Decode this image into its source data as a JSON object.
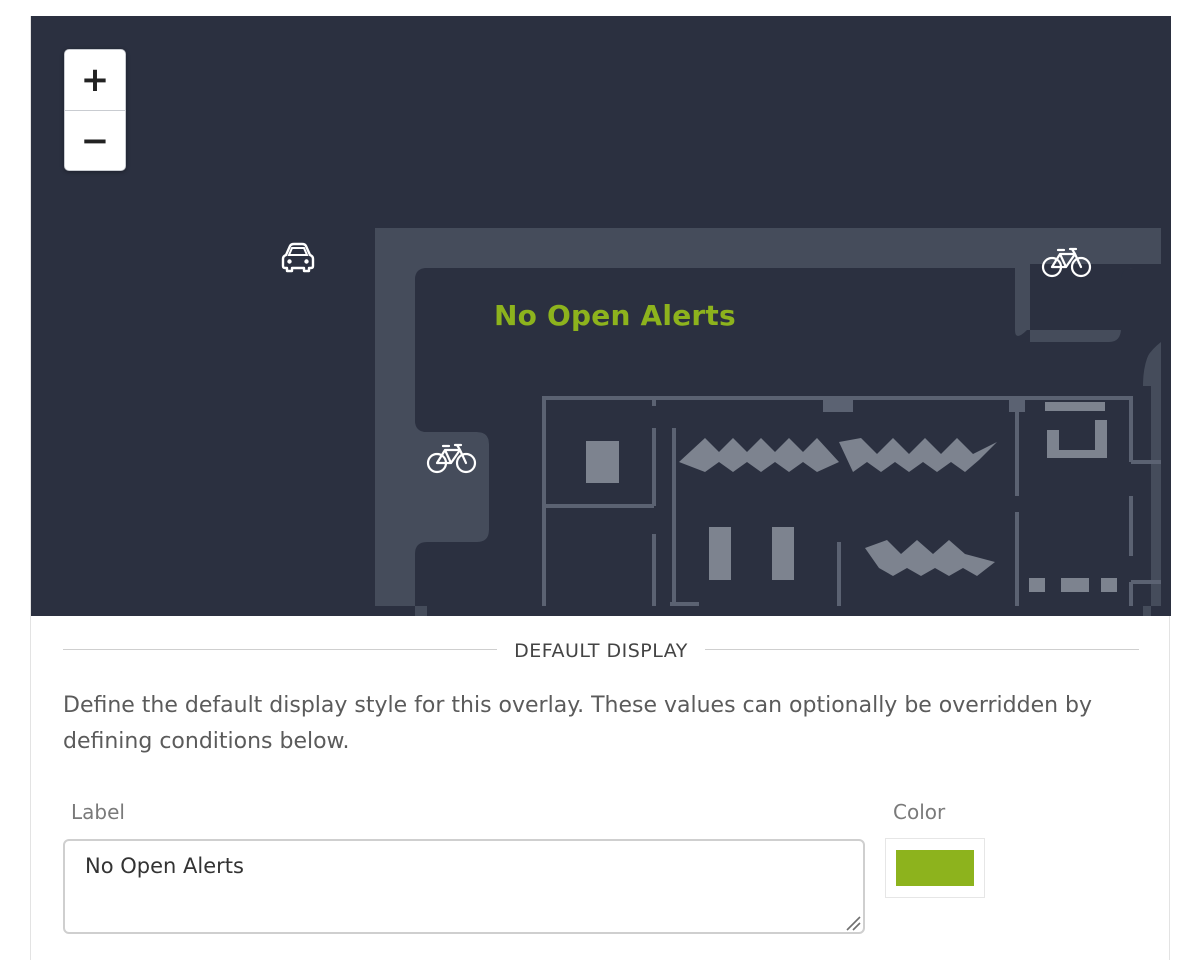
{
  "map": {
    "zoom_in_label": "+",
    "zoom_out_label": "−",
    "alert_label": "No Open Alerts",
    "icons": [
      "car-icon",
      "bicycle-icon",
      "bicycle-icon"
    ],
    "colors": {
      "background": "#2b3040",
      "building": "#454c5b",
      "walls": "#5b6272",
      "furniture": "#7d838f",
      "alert": "#8db31d"
    }
  },
  "default_display": {
    "title": "DEFAULT DISPLAY",
    "description": "Define the default display style for this overlay. These values can optionally be overridden by defining conditions below.",
    "label_field": {
      "label": "Label",
      "value": "No Open Alerts"
    },
    "color_field": {
      "label": "Color",
      "value": "#8db31d"
    }
  }
}
